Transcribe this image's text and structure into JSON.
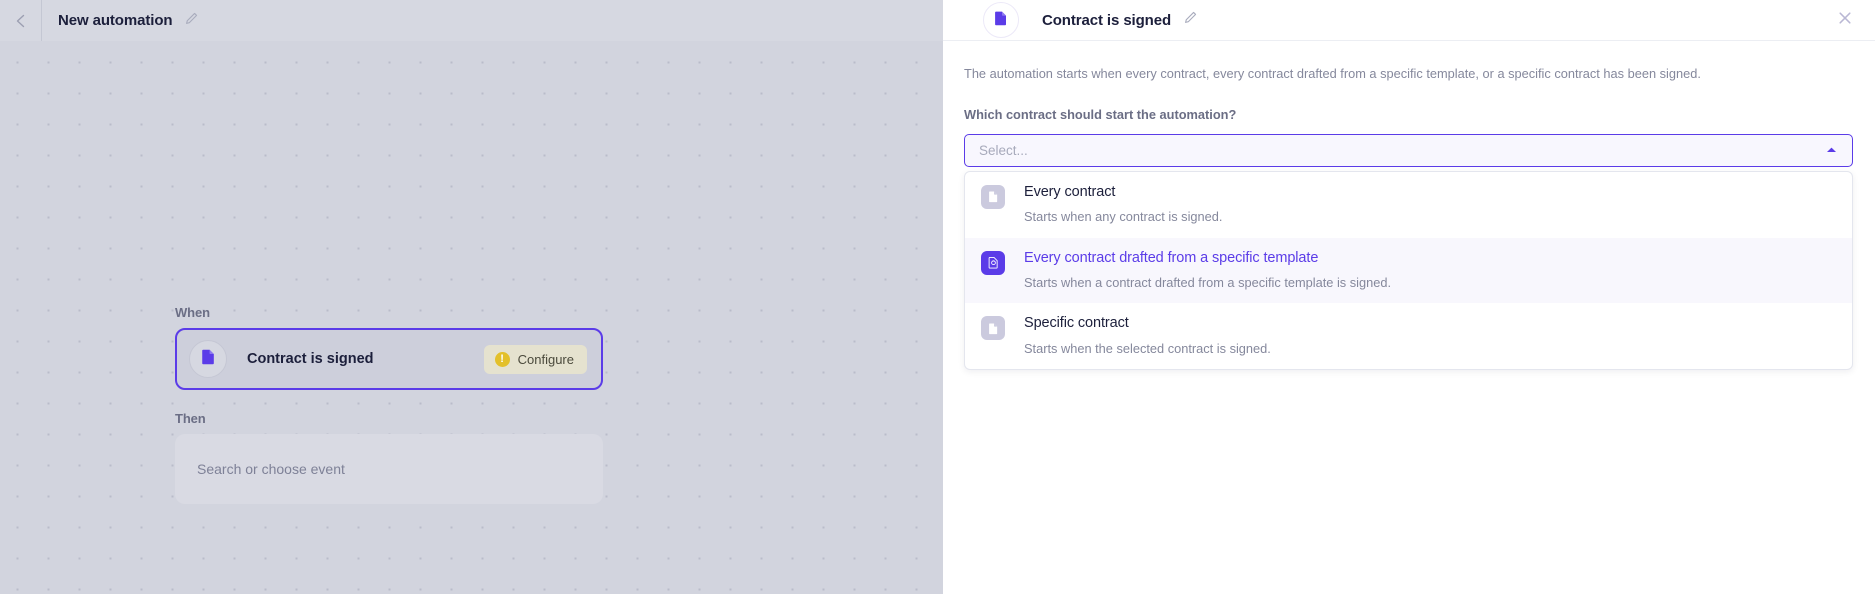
{
  "left": {
    "topbar": {
      "back_icon": "chevron-left-icon",
      "title": "New automation",
      "edit_icon": "pencil-icon"
    },
    "flow": {
      "when_label": "When",
      "when_node": {
        "icon": "contract-document-icon",
        "title": "Contract is signed",
        "configure_label": "Configure",
        "configure_status_icon": "warning-icon",
        "warning_glyph": "!"
      },
      "then_label": "Then",
      "then_node": {
        "placeholder": "Search or choose event"
      }
    }
  },
  "panel": {
    "header": {
      "icon": "contract-document-icon",
      "title": "Contract is signed",
      "edit_icon": "pencil-icon",
      "close_icon": "close-icon"
    },
    "description": "The automation starts when every contract, every contract drafted from a specific template, or a specific contract has been signed.",
    "question": "Which contract should start the automation?",
    "select": {
      "placeholder": "Select...",
      "value": "",
      "caret_icon": "caret-up-icon"
    },
    "options": [
      {
        "icon": "document-icon",
        "label": "Every contract",
        "description": "Starts when any contract is signed.",
        "active": false
      },
      {
        "icon": "document-template-icon",
        "label": "Every contract drafted from a specific template",
        "description": "Starts when a contract drafted from a specific template is signed.",
        "active": true
      },
      {
        "icon": "document-icon",
        "label": "Specific contract",
        "description": "Starts when the selected contract is signed.",
        "active": false
      }
    ]
  },
  "colors": {
    "accent": "#5b3ce8",
    "canvas_bg": "#d2d4de",
    "panel_bg": "#ffffff",
    "warning": "#e3c02a",
    "configure_bg": "#e5e2cf"
  }
}
